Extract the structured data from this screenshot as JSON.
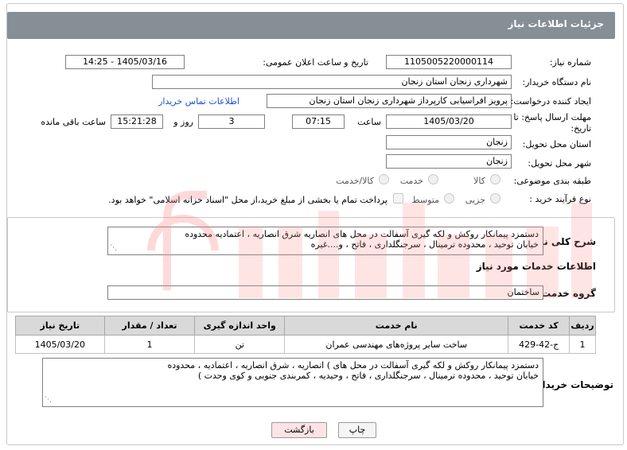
{
  "header": {
    "title": "جزئیات اطلاعات نیاز"
  },
  "form": {
    "need_number_label": "شماره نیاز:",
    "need_number": "1105005220000114",
    "announce_label": "تاریخ و ساعت اعلان عمومی:",
    "announce_value": "1405/03/16 - 14:25",
    "buyer_org_label": "نام دستگاه خریدار:",
    "buyer_org": "شهرداری زنجان استان زنجان",
    "creator_label": "ایجاد کننده درخواست:",
    "creator": "پرویز افراسیابی کارپرداز شهرداری زنجان استان زنجان",
    "contact_link": "اطلاعات تماس خریدار",
    "deadline_label_1": "مهلت ارسال پاسخ: تا",
    "deadline_label_2": "تاریخ:",
    "deadline_date": "1405/03/20",
    "time_label": "ساعت",
    "deadline_time": "07:15",
    "days_value": "3",
    "days_label": "روز و",
    "remaining_time": "15:21:28",
    "remaining_label": "ساعت باقی مانده",
    "province_label": "استان محل تحویل:",
    "province": "زنجان",
    "city_label": "شهر محل تحویل:",
    "city": "زنجان",
    "category_label": "طبقه بندی موضوعی:",
    "category_options": [
      "کالا",
      "خدمت",
      "کالا/خدمت"
    ],
    "process_label": "نوع فرآیند خرید :",
    "process_options": [
      "جزیی",
      "متوسط"
    ],
    "payment_note": "پرداخت تمام یا بخشی از مبلغ خرید،از محل \"اسناد خزانه اسلامی\" خواهد بود."
  },
  "summary": {
    "label": "شرح کلی نیاز:",
    "lines": [
      "دستمزد پیمانکار روکش و لکه گیری آسفالت در محل های انصاریه شرق انصاریه ، اعتمادیه محدوده",
      "خیابان توحید ، محدوده ترمینال ، سرجنگلداری ، فاتح ، و....غیره"
    ]
  },
  "services": {
    "section_title": "اطلاعات خدمات مورد نیاز",
    "group_label": "گروه خدمت:",
    "group_value": "ساختمان",
    "columns": [
      "ردیف",
      "کد خدمت",
      "نام خدمت",
      "واحد اندازه گیری",
      "تعداد / مقدار",
      "تاریخ نیاز"
    ],
    "rows": [
      [
        "1",
        "ج-42-429",
        "ساخت سایر پروژه‌های مهندسی عمران",
        "تن",
        "1",
        "1405/03/20"
      ]
    ]
  },
  "notes": {
    "label": "توضیحات خریدار:",
    "lines": [
      "دستمزد پیمانکار روکش و لکه گیری آسفالت در محل های ) انصاریه ، شرق انصاریه ، اعتمادیه ، محدوده",
      "خیابان توحید ، محدوده ترمینال ، سرجنگلداری ، فاتح ، وحیدیه ، کمربندی جنوبی و کوی وحدت )"
    ]
  },
  "buttons": {
    "print": "چاپ",
    "back": "بازگشت"
  },
  "colors": {
    "header_bg": "#868e96",
    "link": "#1a4fd6",
    "back_bg": "#fde3e5",
    "watermark": "#ff8a8a"
  }
}
